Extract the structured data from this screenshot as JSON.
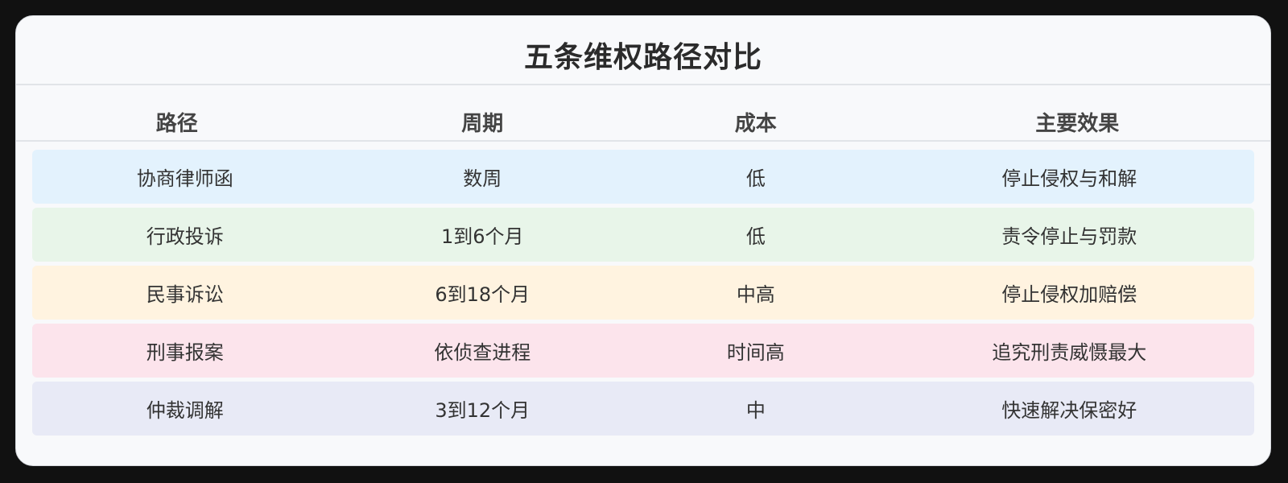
{
  "title": "五条维权路径对比",
  "headers": {
    "path": "路径",
    "period": "周期",
    "cost": "成本",
    "effect": "主要效果"
  },
  "rows": [
    {
      "path": "协商律师函",
      "period": "数周",
      "cost": "低",
      "effect": "停止侵权与和解",
      "color": "#e3f2fd"
    },
    {
      "path": "行政投诉",
      "period": "1到6个月",
      "cost": "低",
      "effect": "责令停止与罚款",
      "color": "#e8f5e9"
    },
    {
      "path": "民事诉讼",
      "period": "6到18个月",
      "cost": "中高",
      "effect": "停止侵权加赔偿",
      "color": "#fff3e0"
    },
    {
      "path": "刑事报案",
      "period": "依侦查进程",
      "cost": "时间高",
      "effect": "追究刑责威慑最大",
      "color": "#fce4ec"
    },
    {
      "path": "仲裁调解",
      "period": "3到12个月",
      "cost": "中",
      "effect": "快速解决保密好",
      "color": "#e8eaf6"
    }
  ]
}
